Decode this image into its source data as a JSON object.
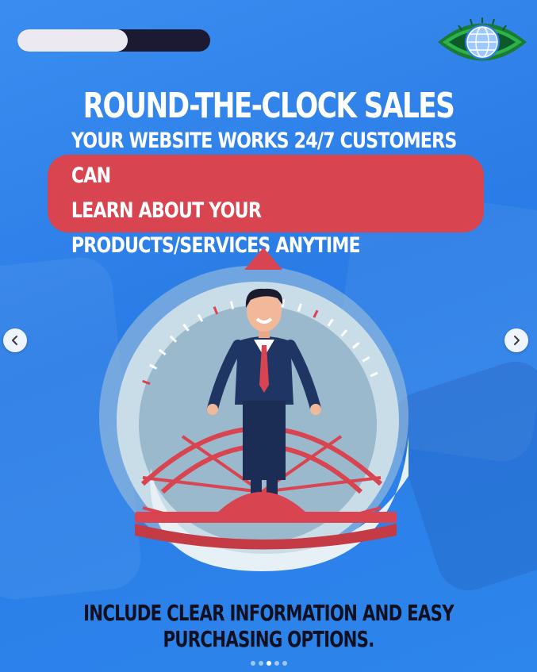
{
  "progress": {
    "fraction": 0.57
  },
  "title": "ROUND-THE-CLOCK SALES",
  "banner": {
    "line1": "YOUR WEBSITE WORKS 24/7 CUSTOMERS CAN",
    "line2": "LEARN ABOUT YOUR PRODUCTS/SERVICES ANYTIME"
  },
  "caption": "INCLUDE CLEAR INFORMATION AND EASY PURCHASING OPTIONS.",
  "carousel": {
    "total": 5,
    "active": 2
  },
  "colors": {
    "background": "#2f7fe0",
    "accent_red": "#d8444f",
    "progress_track": "#1c1933",
    "logo_green": "#2bb34a"
  },
  "icons": {
    "prev": "chevron-left-icon",
    "next": "chevron-right-icon",
    "logo": "eye-globe-logo"
  }
}
